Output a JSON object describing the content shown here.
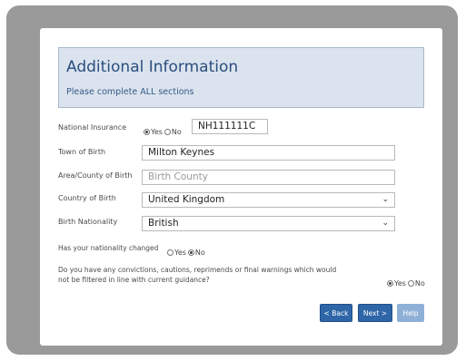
{
  "section": {
    "title": "Additional Information",
    "subtitle": "Please complete ALL sections"
  },
  "fields": {
    "national_insurance": {
      "label": "National Insurance",
      "yes_label": "Yes",
      "no_label": "No",
      "selected": "Yes",
      "value": "NH111111C"
    },
    "town_of_birth": {
      "label": "Town of Birth",
      "value": "Milton Keynes"
    },
    "area_county_of_birth": {
      "label": "Area/County of Birth",
      "placeholder": "Birth County"
    },
    "country_of_birth": {
      "label": "Country of Birth",
      "value": "United Kingdom"
    },
    "birth_nationality": {
      "label": "Birth Nationality",
      "value": "British"
    },
    "nationality_changed": {
      "label": "Has your nationality changed",
      "yes_label": "Yes",
      "no_label": "No",
      "selected": "No"
    },
    "convictions": {
      "question_line1": "Do you have any convictions, cautions, reprimends or final warnings which would",
      "question_line2": "not be filtered in line with current guidance?",
      "yes_label": "Yes",
      "no_label": "No",
      "selected": "Yes"
    }
  },
  "buttons": {
    "back": "< Back",
    "next": "Next >",
    "help": "Help"
  },
  "colors": {
    "frame": "#9a9a9a",
    "header_bg": "#dbe3ee",
    "header_text": "#2a4e7d",
    "primary_button": "#2e66a8",
    "disabled_button": "#8fb0d6"
  }
}
